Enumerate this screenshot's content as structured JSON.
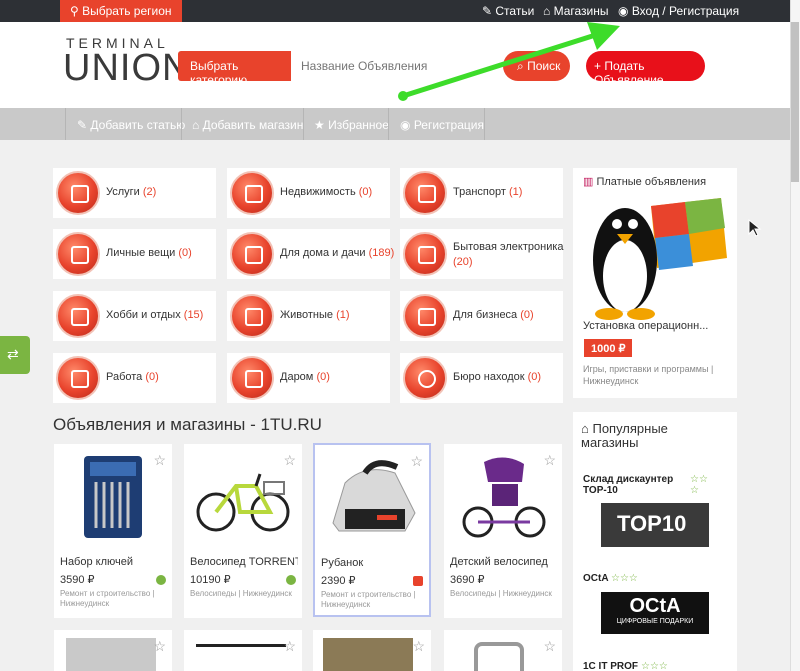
{
  "topbar": {
    "region_label": "Выбрать регион",
    "articles_label": "Статьи",
    "shops_label": "Магазины",
    "login_label": "Вход / Регистрация"
  },
  "header": {
    "logo_top": "TERMINAL",
    "logo_bottom": "UNION",
    "category_button": "Выбрать категорию",
    "search_placeholder": "Название Объявления",
    "search_button": "Поиск",
    "add_ad_button": "+ Подать Объявление"
  },
  "nav": {
    "items": [
      "Добавить статью",
      "Добавить магазин",
      "Избранное",
      "Регистрация"
    ]
  },
  "categories": [
    {
      "label": "Услуги",
      "count": "(2)"
    },
    {
      "label": "Недвижимость",
      "count": "(0)"
    },
    {
      "label": "Транспорт",
      "count": "(1)"
    },
    {
      "label": "Личные вещи",
      "count": "(0)"
    },
    {
      "label": "Для дома и дачи",
      "count": "(189)"
    },
    {
      "label": "Бытовая электроника",
      "count": "(20)"
    },
    {
      "label": "Хобби и отдых",
      "count": "(15)"
    },
    {
      "label": "Животные",
      "count": "(1)"
    },
    {
      "label": "Для бизнеса",
      "count": "(0)"
    },
    {
      "label": "Работа",
      "count": "(0)"
    },
    {
      "label": "Даром",
      "count": "(0)"
    },
    {
      "label": "Бюро находок",
      "count": "(0)"
    }
  ],
  "section_title": "Объявления и магазины - 1TU.RU",
  "ads": [
    {
      "title": "Набор ключей",
      "price": "3590 ₽",
      "meta": "Ремонт и строительство | Нижнеудинск"
    },
    {
      "title": "Велосипед TORRENT",
      "price": "10190 ₽",
      "meta": "Велосипеды | Нижнеудинск"
    },
    {
      "title": "Рубанок",
      "price": "2390 ₽",
      "meta": "Ремонт и строительство | Нижнеудинск"
    },
    {
      "title": "Детский велосипед",
      "price": "3690 ₽",
      "meta": "Велосипеды | Нижнеудинск"
    }
  ],
  "paid_ads": {
    "heading": "Платные объявления",
    "title": "Установка операционн...",
    "price": "1000 ₽",
    "meta": "Игры, приставки и программы | Нижнеудинск"
  },
  "popular_shops": {
    "heading": "Популярные магазины",
    "shops": [
      {
        "name": "Склад дискаунтер TOP-10",
        "logo_text": "TOP10"
      },
      {
        "name": "OCtA",
        "logo_text": "OCtA",
        "logo_sub": "ЦИФРОВЫЕ ПОДАРКИ"
      },
      {
        "name": "1C IT PROF"
      }
    ]
  },
  "colors": {
    "accent": "#e8432c",
    "topbar": "#2d3035",
    "navbar": "#c9c9c9",
    "green": "#7bb542"
  }
}
